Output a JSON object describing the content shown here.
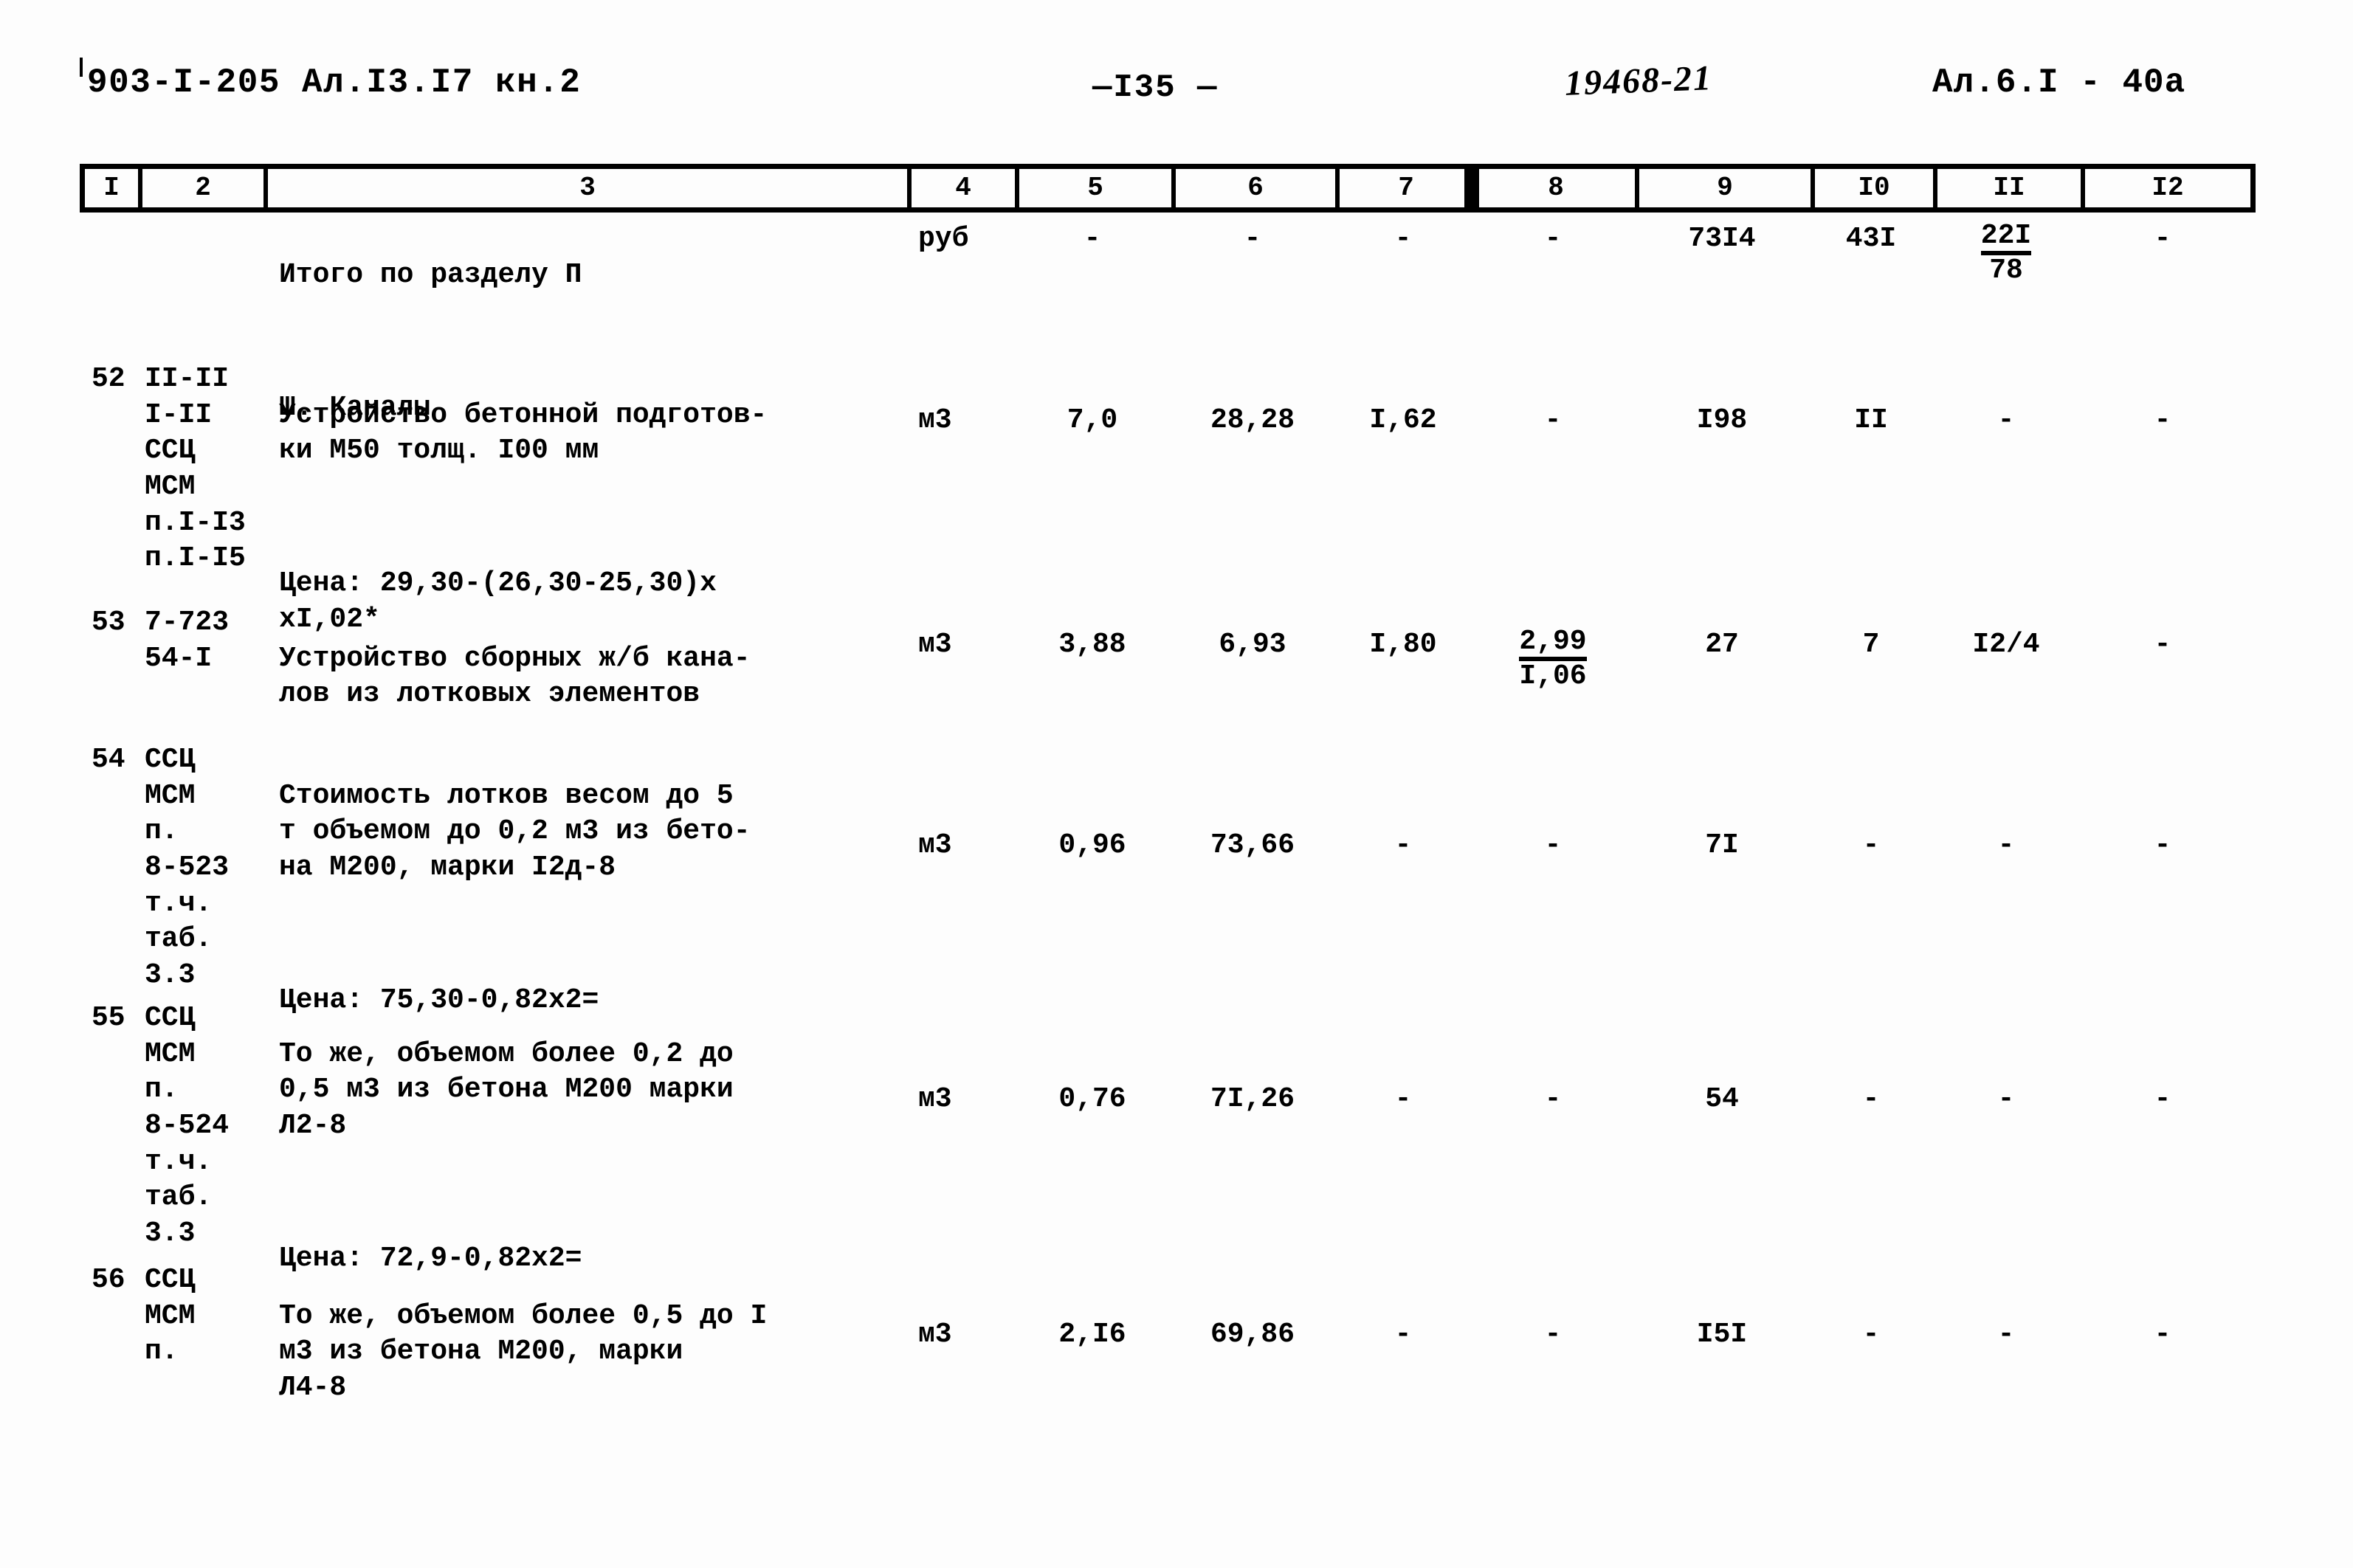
{
  "header": {
    "doc_code": "903-I-205 Ал.I3.I7 кн.2",
    "page_number": "—I35 —",
    "hand_number": "19468-21",
    "sheet_code": "Ал.6.I - 40а"
  },
  "column_numbers": [
    "I",
    "2",
    "3",
    "4",
    "5",
    "6",
    "7",
    "8",
    "9",
    "I0",
    "II",
    "I2"
  ],
  "rows": [
    {
      "num": "",
      "code": "",
      "desc_main": "Итого по разделу П",
      "desc_sub": "Ш. Каналы",
      "unit": "руб",
      "c5": "-",
      "c6": "-",
      "c7": "-",
      "c8": "-",
      "c9": "73I4",
      "c10": "43I",
      "c11_top": "22I",
      "c11_bot": "78",
      "c12": "-"
    },
    {
      "num": "52",
      "code": "II-II\nI-II\nССЦ\nМСМ\nп.I-I3\nп.I-I5",
      "desc_main": "Устройство бетонной подготов-\nки М50 толщ. I00 мм",
      "desc_note": "Цена: 29,30-(26,30-25,30)х\n      xI,02*",
      "unit": "м3",
      "c5": "7,0",
      "c6": "28,28",
      "c7": "I,62",
      "c8": "-",
      "c9": "I98",
      "c10": "II",
      "c11": "-",
      "c12": "-"
    },
    {
      "num": "53",
      "code": "7-723\n54-I",
      "desc_main": "Устройство сборных ж/б кана-\nлов из лотковых элементов",
      "unit": "м3",
      "c5": "3,88",
      "c6": "6,93",
      "c7": "I,80",
      "c8_top": "2,99",
      "c8_bot": "I,06",
      "c9": "27",
      "c10": "7",
      "c11": "I2/4",
      "c12": "-"
    },
    {
      "num": "54",
      "code": "ССЦ\nМСМ\nп.\n8-523\nт.ч.\nтаб.\n3.3",
      "desc_main": "Стоимость лотков весом до 5\nт объемом до 0,2 м3 из бето-\nна М200, марки I2д-8",
      "desc_note": "Цена: 75,30-0,82х2=",
      "unit": "м3",
      "c5": "0,96",
      "c6": "73,66",
      "c7": "-",
      "c8": "-",
      "c9": "7I",
      "c10": "-",
      "c11": "-",
      "c12": "-"
    },
    {
      "num": "55",
      "code": "ССЦ\nМСМ\nп.\n8-524\nт.ч.\nтаб.\n3.3",
      "desc_main": "То же, объемом более 0,2 до\n0,5 м3 из бетона М200 марки\nЛ2-8",
      "desc_note": "Цена: 72,9-0,82х2=",
      "unit": "м3",
      "c5": "0,76",
      "c6": "7I,26",
      "c7": "-",
      "c8": "-",
      "c9": "54",
      "c10": "-",
      "c11": "-",
      "c12": "-"
    },
    {
      "num": "56",
      "code": "ССЦ\nМСМ\nп.",
      "desc_main": "То же, объемом более 0,5 до I\nм3 из бетона М200, марки\nЛ4-8",
      "unit": "м3",
      "c5": "2,I6",
      "c6": "69,86",
      "c7": "-",
      "c8": "-",
      "c9": "I5I",
      "c10": "-",
      "c11": "-",
      "c12": "-"
    }
  ]
}
